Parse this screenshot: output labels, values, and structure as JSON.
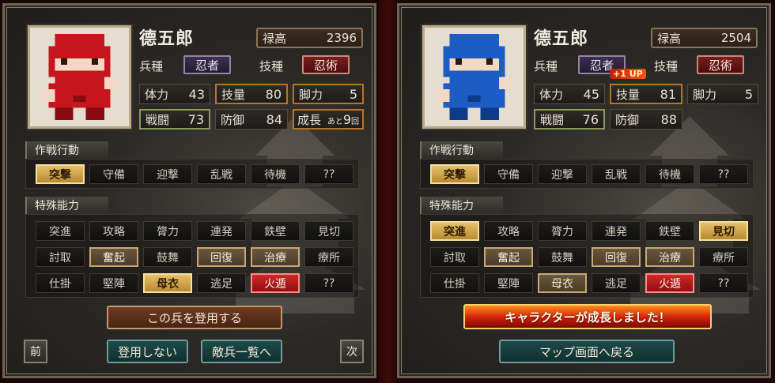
{
  "left": {
    "name": "德五郎",
    "salary_label": "禄高",
    "salary_value": "2396",
    "unit_label": "兵種",
    "unit_value": "忍者",
    "skill_label": "技種",
    "skill_value": "忍術",
    "stats": {
      "hp_label": "体力",
      "hp_value": "43",
      "tech_label": "技量",
      "tech_value": "80",
      "leg_label": "脚力",
      "leg_value": "5",
      "combat_label": "戦闘",
      "combat_value": "73",
      "defense_label": "防御",
      "defense_value": "84",
      "growth_label": "成長",
      "growth_prefix": "あと",
      "growth_value": "9",
      "growth_suffix": "回"
    },
    "tactics_title": "作戦行動",
    "tactics": [
      "突撃",
      "守備",
      "迎撃",
      "乱戦",
      "待機",
      "??"
    ],
    "special_title": "特殊能力",
    "special_rows": [
      [
        "突進",
        "攻略",
        "膂力",
        "連発",
        "鉄壁",
        "見切"
      ],
      [
        "討取",
        "奮起",
        "鼓舞",
        "回復",
        "治療",
        "療所"
      ],
      [
        "仕掛",
        "堅陣",
        "母衣",
        "逃足",
        "火遁",
        "??"
      ]
    ],
    "register_button": "この兵を登用する",
    "prev_button": "前",
    "no_register_button": "登用しない",
    "enemy_list_button": "敵兵一覧へ",
    "next_button": "次"
  },
  "right": {
    "name": "德五郎",
    "salary_label": "禄高",
    "salary_value": "2504",
    "unit_label": "兵種",
    "unit_value": "忍者",
    "skill_label": "技種",
    "skill_value": "忍術",
    "level_up_badge": "+1 UP",
    "stats": {
      "hp_label": "体力",
      "hp_value": "45",
      "tech_label": "技量",
      "tech_value": "81",
      "leg_label": "脚力",
      "leg_value": "5",
      "combat_label": "戦闘",
      "combat_value": "76",
      "defense_label": "防御",
      "defense_value": "88"
    },
    "tactics_title": "作戦行動",
    "tactics": [
      "突撃",
      "守備",
      "迎撃",
      "乱戦",
      "待機",
      "??"
    ],
    "special_title": "特殊能力",
    "special_rows": [
      [
        "突進",
        "攻略",
        "膂力",
        "連発",
        "鉄壁",
        "見切"
      ],
      [
        "討取",
        "奮起",
        "鼓舞",
        "回復",
        "治療",
        "療所"
      ],
      [
        "仕掛",
        "堅陣",
        "母衣",
        "逃足",
        "火遁",
        "??"
      ]
    ],
    "growth_message": "キャラクターが成長しました！",
    "map_button": "マップ画面へ戻る"
  },
  "colors": {
    "ninja_left": "#c4161c",
    "ninja_right": "#1c5cc4",
    "active_gold": "#d9ad52",
    "fire_red": "#d0200a"
  }
}
